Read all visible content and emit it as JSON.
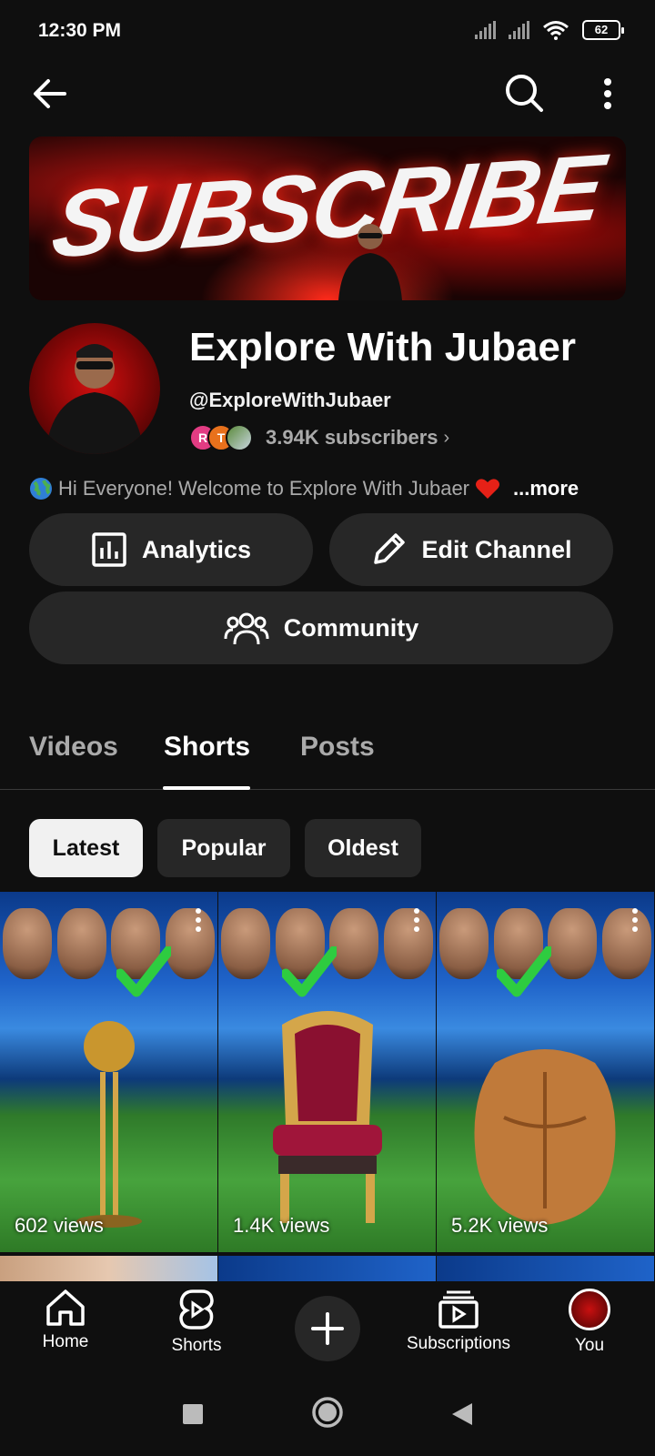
{
  "status": {
    "time": "12:30 PM",
    "battery": "62"
  },
  "channel": {
    "name": "Explore With Jubaer",
    "handle": "@ExploreWithJubaer",
    "subscribers": "3.94K subscribers",
    "description_prefix": "Hi Everyone! Welcome to Explore With Jubaer",
    "more": "...more",
    "banner_text": "SUBSCRIBE",
    "subscriber_avatars": [
      "R",
      "T",
      ""
    ]
  },
  "actions": {
    "analytics": "Analytics",
    "edit_channel": "Edit Channel",
    "community": "Community"
  },
  "tabs": [
    "Videos",
    "Shorts",
    "Posts"
  ],
  "active_tab": "Shorts",
  "chips": [
    "Latest",
    "Popular",
    "Oldest"
  ],
  "active_chip": "Latest",
  "shorts": [
    {
      "views": "602 views"
    },
    {
      "views": "1.4K views"
    },
    {
      "views": "5.2K views"
    }
  ],
  "bottom_nav": {
    "home": "Home",
    "shorts": "Shorts",
    "subscriptions": "Subscriptions",
    "you": "You"
  },
  "colors": {
    "background": "#0f0f0f",
    "surface": "#272727",
    "muted_text": "#aaaaaa",
    "accent_red": "#e62117"
  }
}
